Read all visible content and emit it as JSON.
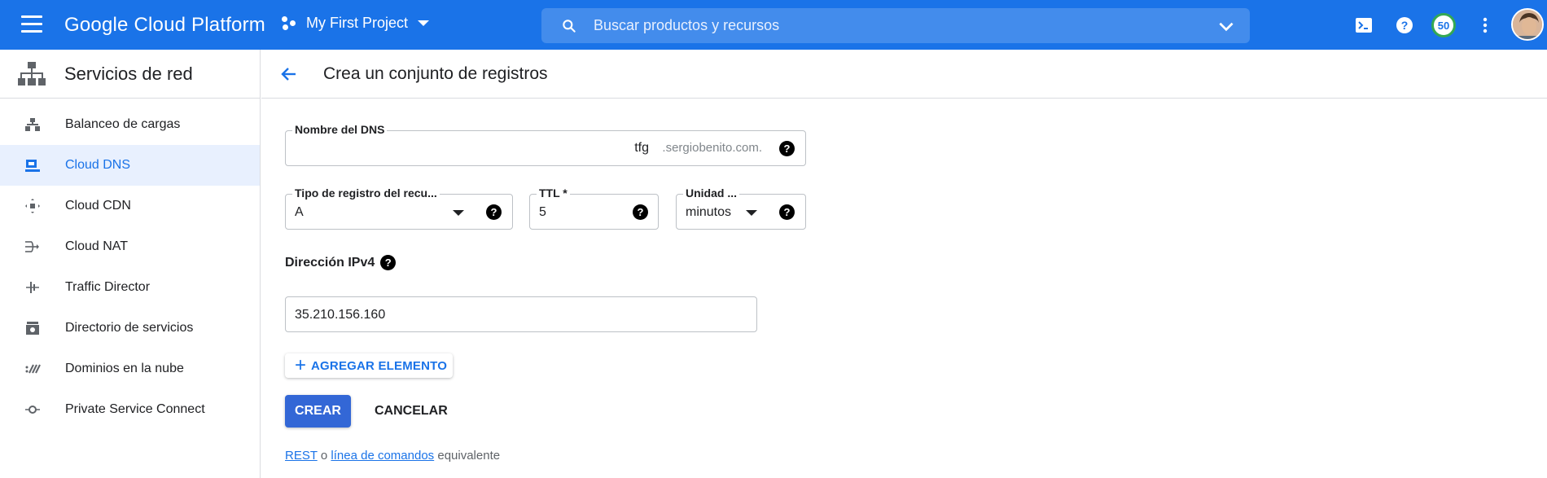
{
  "topbar": {
    "brand": "Google Cloud Platform",
    "project": "My First Project",
    "search_placeholder": "Buscar productos y recursos",
    "badge": "50"
  },
  "sidebar": {
    "title": "Servicios de red",
    "items": [
      {
        "label": "Balanceo de cargas",
        "icon": "load-balancing-icon"
      },
      {
        "label": "Cloud DNS",
        "icon": "dns-icon",
        "active": true
      },
      {
        "label": "Cloud CDN",
        "icon": "cdn-icon"
      },
      {
        "label": "Cloud NAT",
        "icon": "nat-icon"
      },
      {
        "label": "Traffic Director",
        "icon": "traffic-director-icon"
      },
      {
        "label": "Directorio de servicios",
        "icon": "service-directory-icon"
      },
      {
        "label": "Dominios en la nube",
        "icon": "cloud-domains-icon"
      },
      {
        "label": "Private Service Connect",
        "icon": "private-service-connect-icon"
      }
    ]
  },
  "main": {
    "title": "Crea un conjunto de registros",
    "dns_name": {
      "label": "Nombre del DNS",
      "value": "tfg",
      "suffix": ".sergiobenito.com."
    },
    "record_type": {
      "label": "Tipo de registro del recu...",
      "value": "A"
    },
    "ttl": {
      "label": "TTL *",
      "value": "5"
    },
    "unit": {
      "label": "Unidad ...",
      "value": "minutos"
    },
    "ipv4": {
      "label": "Dirección IPv4",
      "value": "35.210.156.160"
    },
    "add_button": "AGREGAR ELEMENTO",
    "create_button": "CREAR",
    "cancel_button": "CANCELAR",
    "rest_link": "REST",
    "rest_or": "o",
    "cli_link": "línea de comandos",
    "rest_suffix": "equivalente"
  },
  "help_glyph": "?",
  "add_glyph": "+"
}
